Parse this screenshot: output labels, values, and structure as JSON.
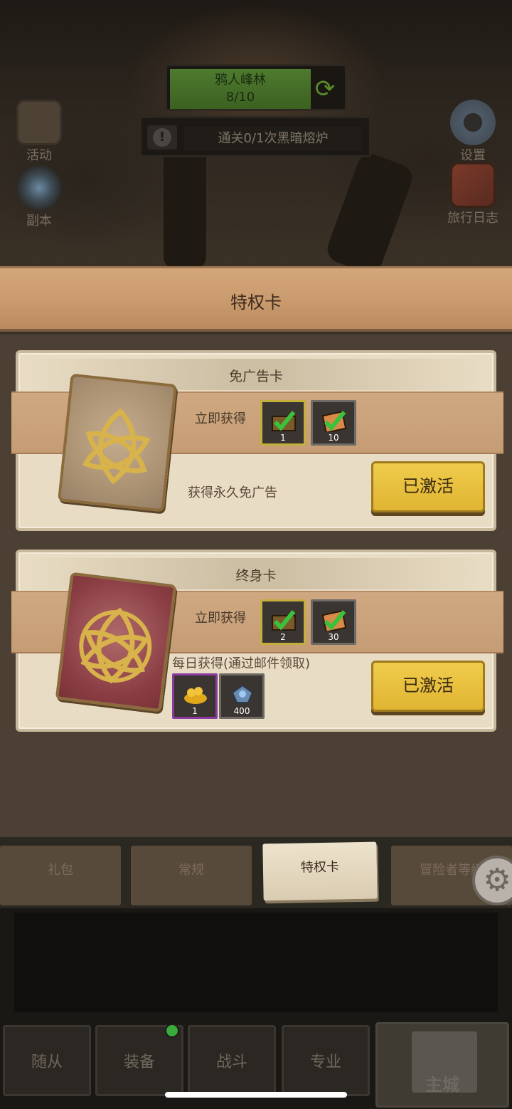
{
  "top": {
    "quest": {
      "name": "鸦人峰林",
      "progress": "8/10"
    },
    "task_text": "通关0/1次黑暗熔炉",
    "left_buttons": [
      {
        "label": "活动"
      },
      {
        "label": "副本"
      }
    ],
    "right_buttons": [
      {
        "label": "设置"
      },
      {
        "label": "旅行日志"
      }
    ]
  },
  "header": {
    "title": "特权卡"
  },
  "cards": [
    {
      "title": "免广告卡",
      "instant_label": "立即获得",
      "instant_items": [
        {
          "icon": "chest-check-icon",
          "qty": "1"
        },
        {
          "icon": "scroll-check-icon",
          "qty": "10"
        }
      ],
      "description": "获得永久免广告",
      "button": "已激活"
    },
    {
      "title": "终身卡",
      "instant_label": "立即获得",
      "instant_items": [
        {
          "icon": "chest-check-icon",
          "qty": "2"
        },
        {
          "icon": "scroll-check-icon",
          "qty": "30"
        }
      ],
      "daily_label": "每日获得(通过邮件领取)",
      "daily_items": [
        {
          "icon": "gold-pile-icon",
          "qty": "1"
        },
        {
          "icon": "gem-icon",
          "qty": "400"
        }
      ],
      "button": "已激活"
    }
  ],
  "tabs": [
    {
      "label": "礼包"
    },
    {
      "label": "常规"
    },
    {
      "label": "特权卡",
      "active": true
    },
    {
      "label": "冒险者等级"
    }
  ],
  "nav": [
    {
      "label": "随从"
    },
    {
      "label": "装备"
    },
    {
      "label": "战斗"
    },
    {
      "label": "专业"
    },
    {
      "label": "主城"
    }
  ],
  "colors": {
    "accent_yellow": "#e0b432",
    "header_wood": "#c8996c",
    "card_bg": "#e8dcc4"
  }
}
